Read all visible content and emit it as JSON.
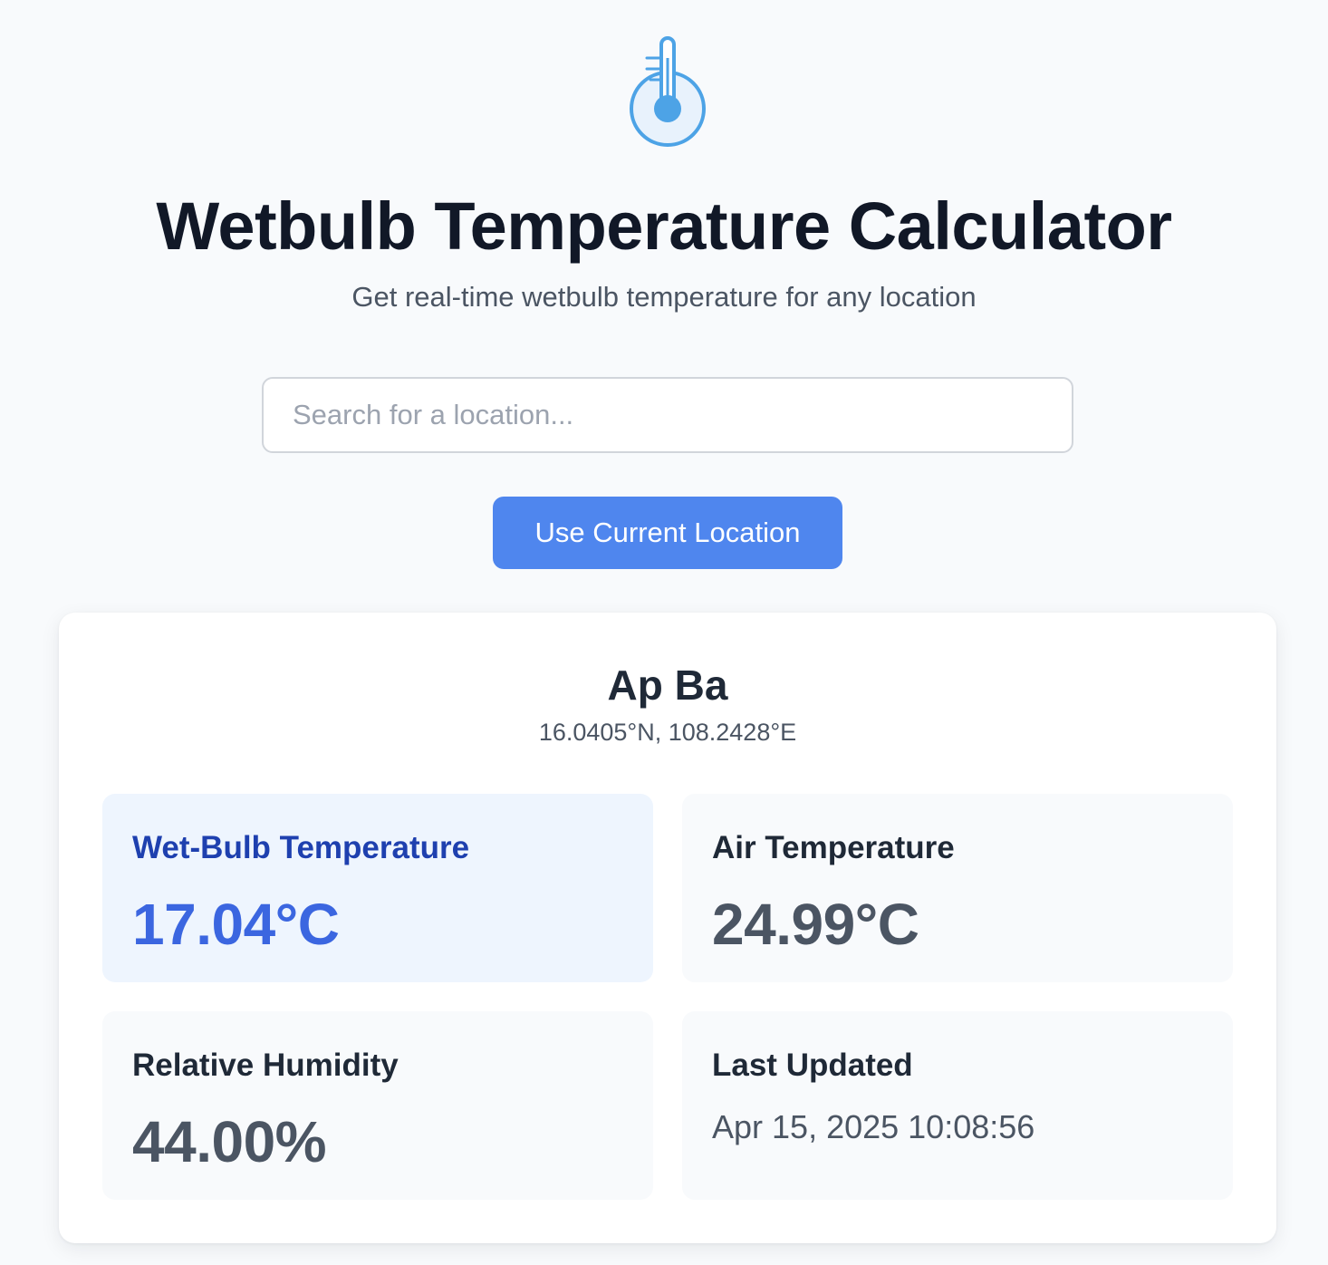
{
  "header": {
    "logo_icon": "thermometer-icon",
    "title": "Wetbulb Temperature Calculator",
    "subtitle": "Get real-time wetbulb temperature for any location"
  },
  "search": {
    "value": "",
    "placeholder": "Search for a location..."
  },
  "actions": {
    "use_location_label": "Use Current Location"
  },
  "location": {
    "name": "Ap Ba",
    "coords": "16.0405°N, 108.2428°E"
  },
  "metrics": {
    "wet_bulb": {
      "label": "Wet-Bulb Temperature",
      "value": "17.04°C"
    },
    "air_temp": {
      "label": "Air Temperature",
      "value": "24.99°C"
    },
    "humidity": {
      "label": "Relative Humidity",
      "value": "44.00%"
    },
    "updated": {
      "label": "Last Updated",
      "value": "Apr 15, 2025 10:08:56"
    }
  },
  "colors": {
    "accent": "#4f86ee",
    "wet_bulb_value": "#3b66e0",
    "wet_bulb_label": "#1e40af",
    "wet_bulb_tile": "#eef5fe",
    "page_background": "#f8fafc"
  }
}
